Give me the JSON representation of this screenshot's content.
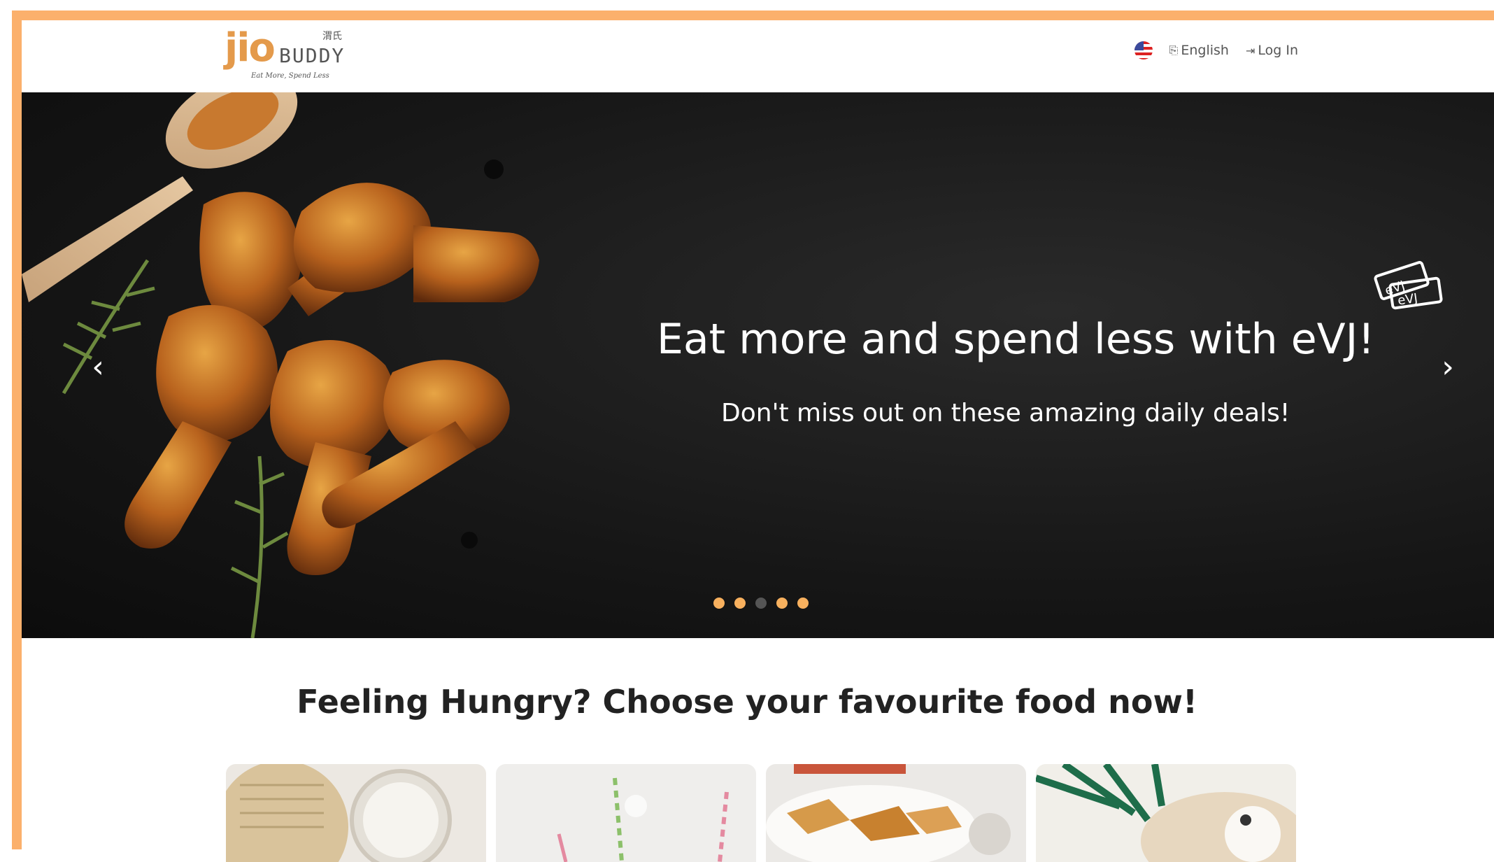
{
  "header": {
    "logo": {
      "main": "jio",
      "sub": "BUDDY",
      "cn": "渭氏",
      "tagline": "Eat More, Spend Less"
    },
    "language_flag": "us-flag-icon",
    "language_label": "English",
    "login_label": "Log In"
  },
  "hero": {
    "title": "Eat more and spend less with eVJ!",
    "subtitle": "Don't miss out on these amazing daily deals!",
    "badge_text": "eVJ",
    "slides_count": 5,
    "active_slide": 3
  },
  "section": {
    "title": "Feeling Hungry? Choose your favourite food now!"
  },
  "colors": {
    "accent": "#fbb06c",
    "dot_active": "#555555",
    "dot_inactive": "#f7b05e"
  }
}
